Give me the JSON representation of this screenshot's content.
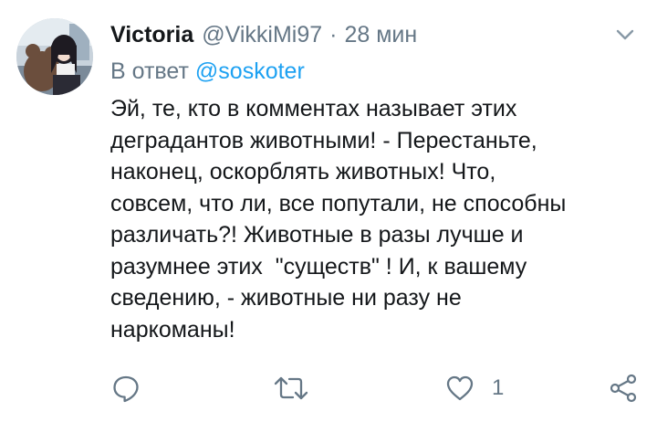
{
  "tweet": {
    "name": "Victoria",
    "handle": "@VikkiMi97",
    "separator": "·",
    "time": "28 мин",
    "reply_prefix": "В ответ",
    "reply_mention": "@soskoter",
    "text_lines": [
      "Эй, те, кто в комментах называет этих",
      "деградантов животными! - Перестаньте,",
      "наконец, оскорблять животных! Что,",
      "совсем, что ли, все попутали, не способны",
      "различать?! Животные в разы лучше и",
      "разумнее этих  \"существ\" ! И, к вашему",
      "сведению, - животные ни разу не",
      "наркоманы!"
    ]
  },
  "actions": {
    "reply_icon": "reply-icon",
    "retweet_icon": "retweet-icon",
    "like_icon": "like-icon",
    "like_count": "1",
    "share_icon": "share-icon"
  },
  "colors": {
    "text": "#14171a",
    "secondary": "#657786",
    "link": "#1da1f2"
  }
}
